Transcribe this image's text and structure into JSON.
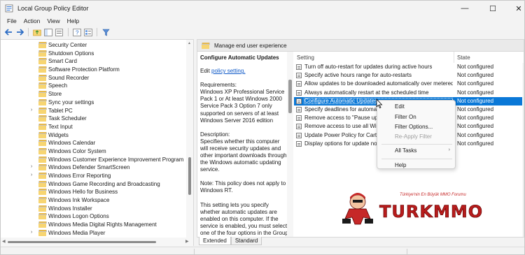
{
  "window": {
    "title": "Local Group Policy Editor",
    "minimize_glyph": "—",
    "maximize_glyph": "☐",
    "close_glyph": "✕"
  },
  "menu": [
    "File",
    "Action",
    "View",
    "Help"
  ],
  "toolbar": {
    "icons": [
      "back-arrow-icon",
      "forward-arrow-icon",
      "up-folder-icon",
      "show-hide-tree-icon",
      "export-list-icon",
      "help-icon",
      "properties-icon",
      "filter-icon"
    ]
  },
  "tree": {
    "items": [
      {
        "label": "Security Center",
        "expandable": false
      },
      {
        "label": "Shutdown Options",
        "expandable": false
      },
      {
        "label": "Smart Card",
        "expandable": false
      },
      {
        "label": "Software Protection Platform",
        "expandable": false
      },
      {
        "label": "Sound Recorder",
        "expandable": false
      },
      {
        "label": "Speech",
        "expandable": false
      },
      {
        "label": "Store",
        "expandable": false
      },
      {
        "label": "Sync your settings",
        "expandable": false
      },
      {
        "label": "Tablet PC",
        "expandable": true
      },
      {
        "label": "Task Scheduler",
        "expandable": false
      },
      {
        "label": "Text Input",
        "expandable": false
      },
      {
        "label": "Widgets",
        "expandable": false
      },
      {
        "label": "Windows Calendar",
        "expandable": false
      },
      {
        "label": "Windows Color System",
        "expandable": false
      },
      {
        "label": "Windows Customer Experience Improvement Program",
        "expandable": false
      },
      {
        "label": "Windows Defender SmartScreen",
        "expandable": true
      },
      {
        "label": "Windows Error Reporting",
        "expandable": true
      },
      {
        "label": "Windows Game Recording and Broadcasting",
        "expandable": false
      },
      {
        "label": "Windows Hello for Business",
        "expandable": false
      },
      {
        "label": "Windows Ink Workspace",
        "expandable": false
      },
      {
        "label": "Windows Installer",
        "expandable": false
      },
      {
        "label": "Windows Logon Options",
        "expandable": false
      },
      {
        "label": "Windows Media Digital Rights Management",
        "expandable": false
      },
      {
        "label": "Windows Media Player",
        "expandable": true
      }
    ]
  },
  "pane": {
    "header": "Manage end user experience",
    "description": {
      "title": "Configure Automatic Updates",
      "edit_prefix": "Edit ",
      "edit_link": "policy setting.",
      "requirements": "Requirements:\nWindows XP Professional Service Pack 1 or At least Windows 2000 Service Pack 3 Option 7 only supported on servers of at least Windows Server 2016 edition",
      "description": "Description:\nSpecifies whether this computer will receive security updates and other important downloads through the Windows automatic updating service.",
      "note": "Note: This policy does not apply to Windows RT.",
      "body": "This setting lets you specify whether automatic updates are enabled on this computer. If the service is enabled, you must select one of the four options in the Group Policy Setting:"
    },
    "columns": {
      "setting": "Setting",
      "state": "State"
    },
    "settings": [
      {
        "name": "Turn off auto-restart for updates during active hours",
        "state": "Not configured"
      },
      {
        "name": "Specify active hours range for auto-restarts",
        "state": "Not configured"
      },
      {
        "name": "Allow updates to be downloaded automatically over metered...",
        "state": "Not configured"
      },
      {
        "name": "Always automatically restart at the scheduled time",
        "state": "Not configured"
      },
      {
        "name": "Configure Automatic Updates",
        "state": "Not configured",
        "selected": true
      },
      {
        "name": "Specify deadlines for automatic",
        "state": "Not configured"
      },
      {
        "name": "Remove access to \"Pause updat",
        "state": "Not configured"
      },
      {
        "name": "Remove access to use all Windo",
        "state": "Not configured"
      },
      {
        "name": "Update Power Policy for Cart Re",
        "state": "Not configured"
      },
      {
        "name": "Display options for update noti",
        "state": "Not configured"
      }
    ]
  },
  "context_menu": {
    "items": [
      {
        "label": "Edit",
        "disabled": false
      },
      {
        "label": "Filter On",
        "disabled": false
      },
      {
        "label": "Filter Options...",
        "disabled": false
      },
      {
        "label": "Re-Apply Filter",
        "disabled": true
      },
      {
        "label": "All Tasks",
        "disabled": false,
        "submenu_glyph": "›"
      },
      {
        "label": "Help",
        "disabled": false
      }
    ]
  },
  "tabs": [
    "Extended",
    "Standard"
  ],
  "watermark": {
    "caption": "Türkiye'nin En Büyük MMO Forumu",
    "text": "TURKMMO"
  },
  "colors": {
    "selection": "#0a78d7",
    "link": "#0b57c7",
    "folder": "#f7d572"
  }
}
